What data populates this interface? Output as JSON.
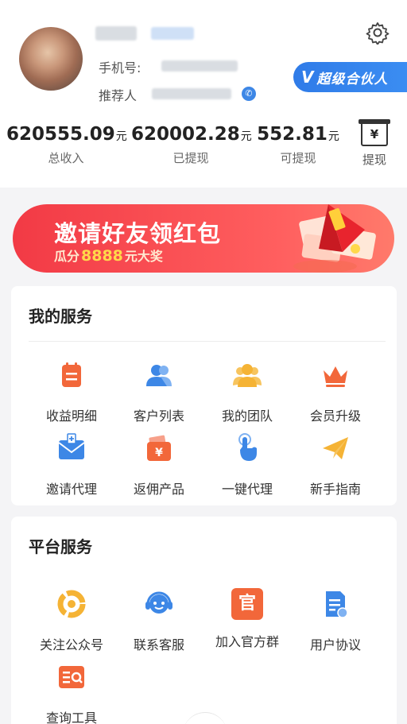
{
  "profile": {
    "phone_label": "手机号:",
    "referrer_label": "推荐人",
    "vip_badge": "超级合伙人",
    "vip_mark": "V"
  },
  "stats": [
    {
      "value": "620555.09",
      "unit": "元",
      "label": "总收入"
    },
    {
      "value": "620002.28",
      "unit": "元",
      "label": "已提现"
    },
    {
      "value": "552.81",
      "unit": "元",
      "label": "可提现"
    }
  ],
  "withdraw": {
    "icon": "yen-machine-icon",
    "symbol": "¥",
    "label": "提现"
  },
  "banner": {
    "title": "邀请好友领红包",
    "sub_prefix": "瓜分",
    "sub_amount": "8888",
    "sub_suffix": "元大奖"
  },
  "my_services": {
    "title": "我的服务",
    "items": [
      {
        "label": "收益明细",
        "icon": "income-detail-icon"
      },
      {
        "label": "客户列表",
        "icon": "customer-list-icon"
      },
      {
        "label": "我的团队",
        "icon": "my-team-icon"
      },
      {
        "label": "会员升级",
        "icon": "crown-icon"
      },
      {
        "label": "邀请代理",
        "icon": "invite-mail-icon"
      },
      {
        "label": "返佣产品",
        "icon": "wallet-yen-icon"
      },
      {
        "label": "一键代理",
        "icon": "tap-hand-icon"
      },
      {
        "label": "新手指南",
        "icon": "paper-plane-icon"
      }
    ]
  },
  "platform_services": {
    "title": "平台服务",
    "items": [
      {
        "label": "关注公众号",
        "icon": "official-account-icon"
      },
      {
        "label": "联系客服",
        "icon": "headset-icon"
      },
      {
        "label": "加入官方群",
        "icon": "official-group-icon",
        "glyph": "官"
      },
      {
        "label": "用户协议",
        "icon": "user-agreement-icon"
      },
      {
        "label": "查询工具",
        "icon": "query-tool-icon"
      }
    ]
  },
  "colors": {
    "accent": "#3b8df2",
    "banner": "#f23a45",
    "orange": "#f2673a",
    "blue": "#3d87e6",
    "yellow": "#f5b335"
  }
}
